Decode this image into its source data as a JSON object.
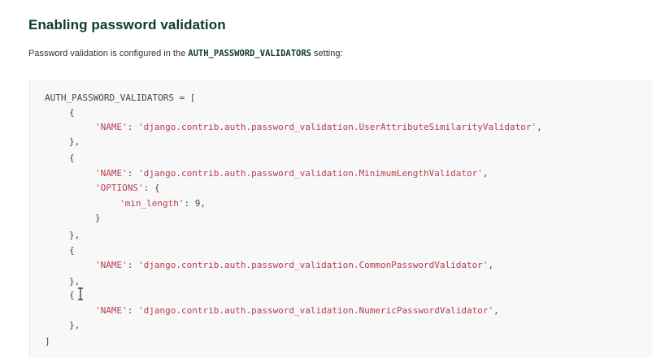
{
  "section": {
    "title": "Enabling password validation",
    "intro_before": "Password validation is configured in the ",
    "intro_setting": "AUTH_PASSWORD_VALIDATORS",
    "intro_after": " setting:"
  },
  "code": {
    "l1": "AUTH_PASSWORD_VALIDATORS = [",
    "open_brace": "{",
    "close_brace_comma": "},",
    "close_brace": "}",
    "close_bracket": "]",
    "name_key": "'NAME'",
    "options_key": "'OPTIONS'",
    "min_length_key": "'min_length'",
    "min_length_value": "9",
    "v1": "'django.contrib.auth.password_validation.UserAttributeSimilarityValidator'",
    "v2": "'django.contrib.auth.password_validation.MinimumLengthValidator'",
    "v3": "'django.contrib.auth.password_validation.CommonPasswordValidator'",
    "v4": "'django.contrib.auth.password_validation.NumericPasswordValidator'",
    "colon": ": ",
    "comma": ",",
    "options_open": ": {"
  }
}
